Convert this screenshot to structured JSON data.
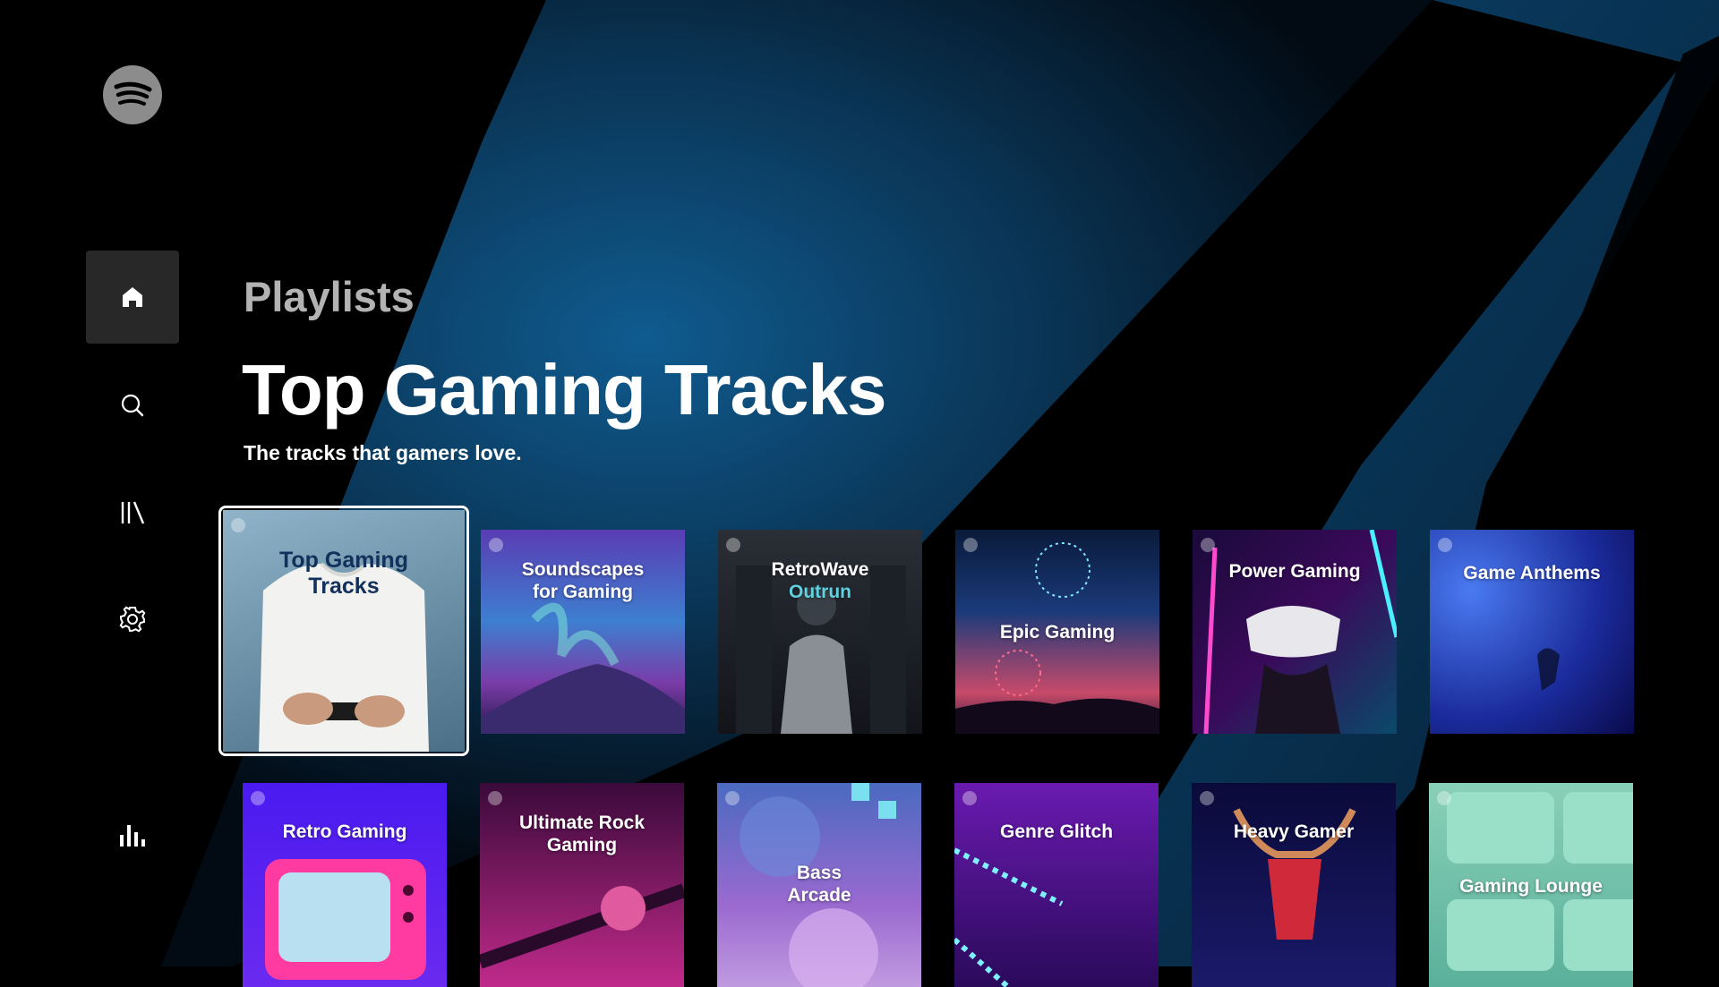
{
  "nav": {
    "items": [
      {
        "name": "home",
        "icon": "home-icon",
        "active": true
      },
      {
        "name": "search",
        "icon": "search-icon",
        "active": false
      },
      {
        "name": "library",
        "icon": "library-icon",
        "active": false
      },
      {
        "name": "settings",
        "icon": "gear-icon",
        "active": false
      },
      {
        "name": "stats",
        "icon": "equalizer-icon",
        "active": false
      }
    ]
  },
  "header": {
    "category": "Playlists",
    "title": "Top Gaming Tracks",
    "subtitle": "The tracks that gamers love."
  },
  "playlists": {
    "row1": [
      {
        "title_line1": "Top Gaming",
        "title_line2": "Tracks",
        "selected": true
      },
      {
        "title_line1": "Soundscapes",
        "title_line2": "for Gaming"
      },
      {
        "title_line1": "RetroWave",
        "title_line2": "Outrun"
      },
      {
        "title_line1": "Epic Gaming",
        "title_line2": ""
      },
      {
        "title_line1": "Power Gaming",
        "title_line2": ""
      },
      {
        "title_line1": "Game Anthems",
        "title_line2": ""
      }
    ],
    "row2": [
      {
        "title_line1": "Retro Gaming",
        "title_line2": ""
      },
      {
        "title_line1": "Ultimate Rock",
        "title_line2": "Gaming"
      },
      {
        "title_line1": "Bass",
        "title_line2": "Arcade"
      },
      {
        "title_line1": "Genre Glitch",
        "title_line2": ""
      },
      {
        "title_line1": "Heavy Gamer",
        "title_line2": ""
      },
      {
        "title_line1": "Gaming Lounge",
        "title_line2": ""
      }
    ]
  },
  "colors": {
    "background": "#000000",
    "accent_blue": "#0b4a78",
    "nav_active": "#282828",
    "category_text": "#b3b3b3"
  }
}
